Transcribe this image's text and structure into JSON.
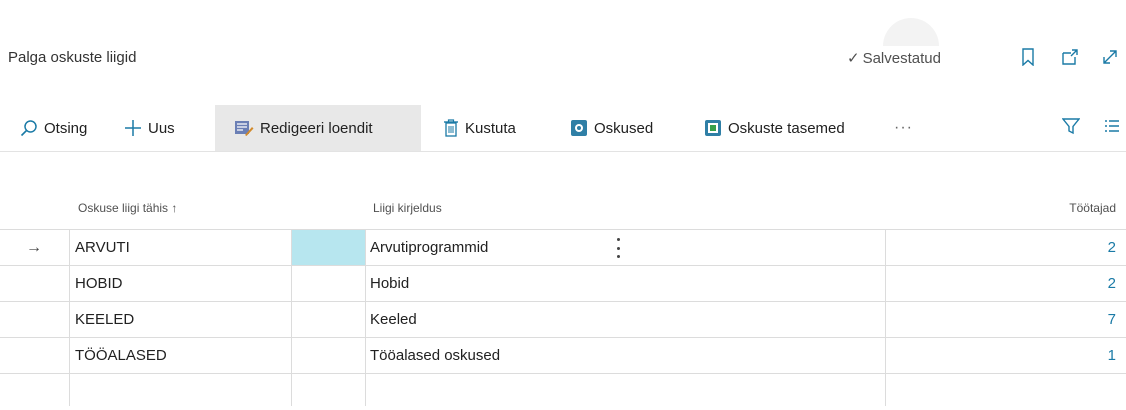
{
  "header": {
    "title": "Palga oskuste liigid",
    "saved_label": "Salvestatud",
    "icons": [
      "bookmark-icon",
      "open-new-window-icon",
      "expand-icon"
    ]
  },
  "toolbar": {
    "search": "Otsing",
    "new": "Uus",
    "edit_list": "Redigeeri loendit",
    "delete": "Kustuta",
    "skills": "Oskused",
    "skill_levels": "Oskuste tasemed",
    "more": "···"
  },
  "table": {
    "columns": {
      "code": "Oskuse liigi tähis ↑",
      "description": "Liigi kirjeldus",
      "employees": "Töötajad"
    },
    "rows": [
      {
        "code": "ARVUTI",
        "description": "Arvutiprogrammid",
        "employees": "2"
      },
      {
        "code": "HOBID",
        "description": "Hobid",
        "employees": "2"
      },
      {
        "code": "KEELED",
        "description": "Keeled",
        "employees": "7"
      },
      {
        "code": "TÖÖALASED",
        "description": "Tööalased oskused",
        "employees": "1"
      }
    ],
    "current_row_marker": "→"
  },
  "colors": {
    "accent": "#1a7aa6",
    "selection": "#b7e6ef",
    "active_tool": "#e8e8e8"
  }
}
